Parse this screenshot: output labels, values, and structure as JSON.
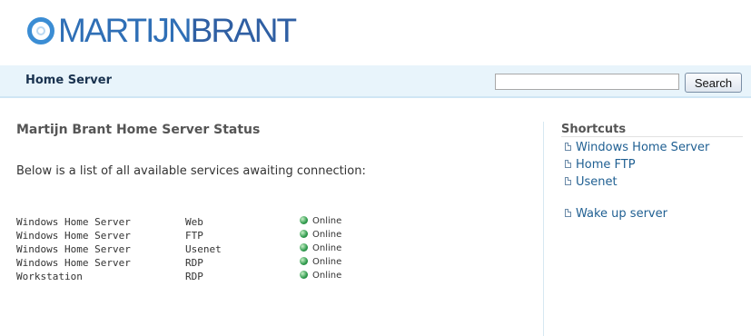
{
  "logo": {
    "part1": "MARTIJN",
    "part2": "BRANT"
  },
  "nav": {
    "home_label": "Home Server"
  },
  "search": {
    "placeholder": "",
    "value": "",
    "button_label": "Search"
  },
  "main": {
    "title": "Martijn Brant Home Server Status",
    "intro": "Below is a list of all available services awaiting connection:",
    "services": [
      {
        "host": "Windows Home Server",
        "type": "Web",
        "status": "Online"
      },
      {
        "host": "Windows Home Server",
        "type": "FTP",
        "status": "Online"
      },
      {
        "host": "Windows Home Server",
        "type": "Usenet",
        "status": "Online"
      },
      {
        "host": "Windows Home Server",
        "type": "RDP",
        "status": "Online"
      },
      {
        "host": "Workstation",
        "type": "RDP",
        "status": "Online"
      }
    ]
  },
  "sidebar": {
    "title": "Shortcuts",
    "links": [
      {
        "label": "Windows Home Server"
      },
      {
        "label": "Home FTP"
      },
      {
        "label": "Usenet"
      },
      {
        "label": "Wake up server"
      }
    ]
  },
  "colors": {
    "nav_bg": "#e8f4fb",
    "link": "#1f5f92",
    "status_online": "#2e9a4c"
  }
}
